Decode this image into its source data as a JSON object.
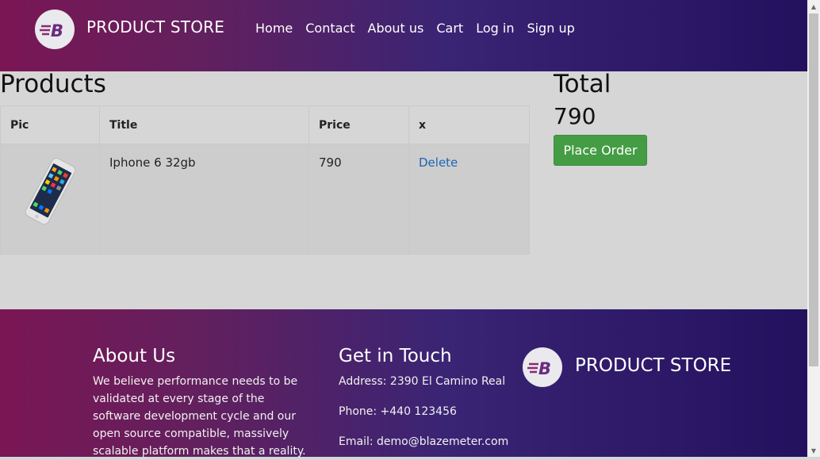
{
  "nav": {
    "brand": "PRODUCT STORE",
    "links": [
      "Home",
      "Contact",
      "About us",
      "Cart",
      "Log in",
      "Sign up"
    ]
  },
  "cart": {
    "title": "Products",
    "columns": [
      "Pic",
      "Title",
      "Price",
      "x"
    ],
    "rows": [
      {
        "pic": "iphone-image",
        "title": "Iphone 6 32gb",
        "price": "790",
        "action": "Delete"
      }
    ],
    "total_label": "Total",
    "total_value": "790",
    "place_order_label": "Place Order"
  },
  "footer": {
    "about_title": "About Us",
    "about_text": "We believe performance needs to be validated at every stage of the software development cycle and our open source compatible, massively scalable platform makes that a reality.",
    "touch_title": "Get in Touch",
    "address": "Address: 2390 El Camino Real",
    "phone": "Phone: +440 123456",
    "email": "Email: demo@blazemeter.com",
    "brand": "PRODUCT STORE"
  },
  "colors": {
    "gradient_start": "#7b1654",
    "gradient_end": "#23115e",
    "place_order_green": "#449d44",
    "link_blue": "#1865b5"
  }
}
